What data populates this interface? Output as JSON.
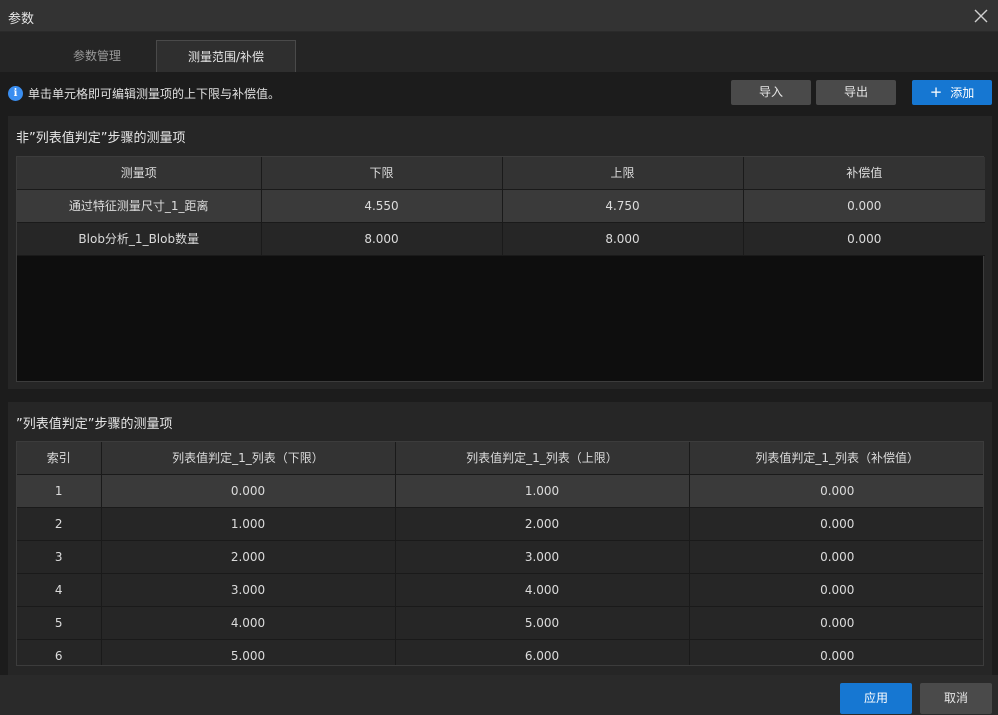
{
  "window": {
    "title": "参数"
  },
  "tabs": [
    {
      "label": "参数管理"
    },
    {
      "label": "测量范围/补偿"
    }
  ],
  "info": {
    "text": "单击单元格即可编辑测量项的上下限与补偿值。"
  },
  "toolbar": {
    "import_label": "导入",
    "export_label": "导出",
    "add_label": "添加"
  },
  "section1": {
    "title": "非”列表值判定”步骤的测量项",
    "columns": [
      "测量项",
      "下限",
      "上限",
      "补偿值"
    ],
    "rows": [
      [
        "通过特征测量尺寸_1_距离",
        "4.550",
        "4.750",
        "0.000"
      ],
      [
        "Blob分析_1_Blob数量",
        "8.000",
        "8.000",
        "0.000"
      ]
    ]
  },
  "section2": {
    "title": "”列表值判定”步骤的测量项",
    "columns": [
      "索引",
      "列表值判定_1_列表（下限）",
      "列表值判定_1_列表（上限）",
      "列表值判定_1_列表（补偿值）"
    ],
    "rows": [
      [
        "1",
        "0.000",
        "1.000",
        "0.000"
      ],
      [
        "2",
        "1.000",
        "2.000",
        "0.000"
      ],
      [
        "3",
        "2.000",
        "3.000",
        "0.000"
      ],
      [
        "4",
        "3.000",
        "4.000",
        "0.000"
      ],
      [
        "5",
        "4.000",
        "5.000",
        "0.000"
      ],
      [
        "6",
        "5.000",
        "6.000",
        "0.000"
      ]
    ]
  },
  "footer": {
    "apply_label": "应用",
    "cancel_label": "取消"
  },
  "colors": {
    "accent": "#1677d2",
    "info_icon": "#3a8ef0"
  }
}
